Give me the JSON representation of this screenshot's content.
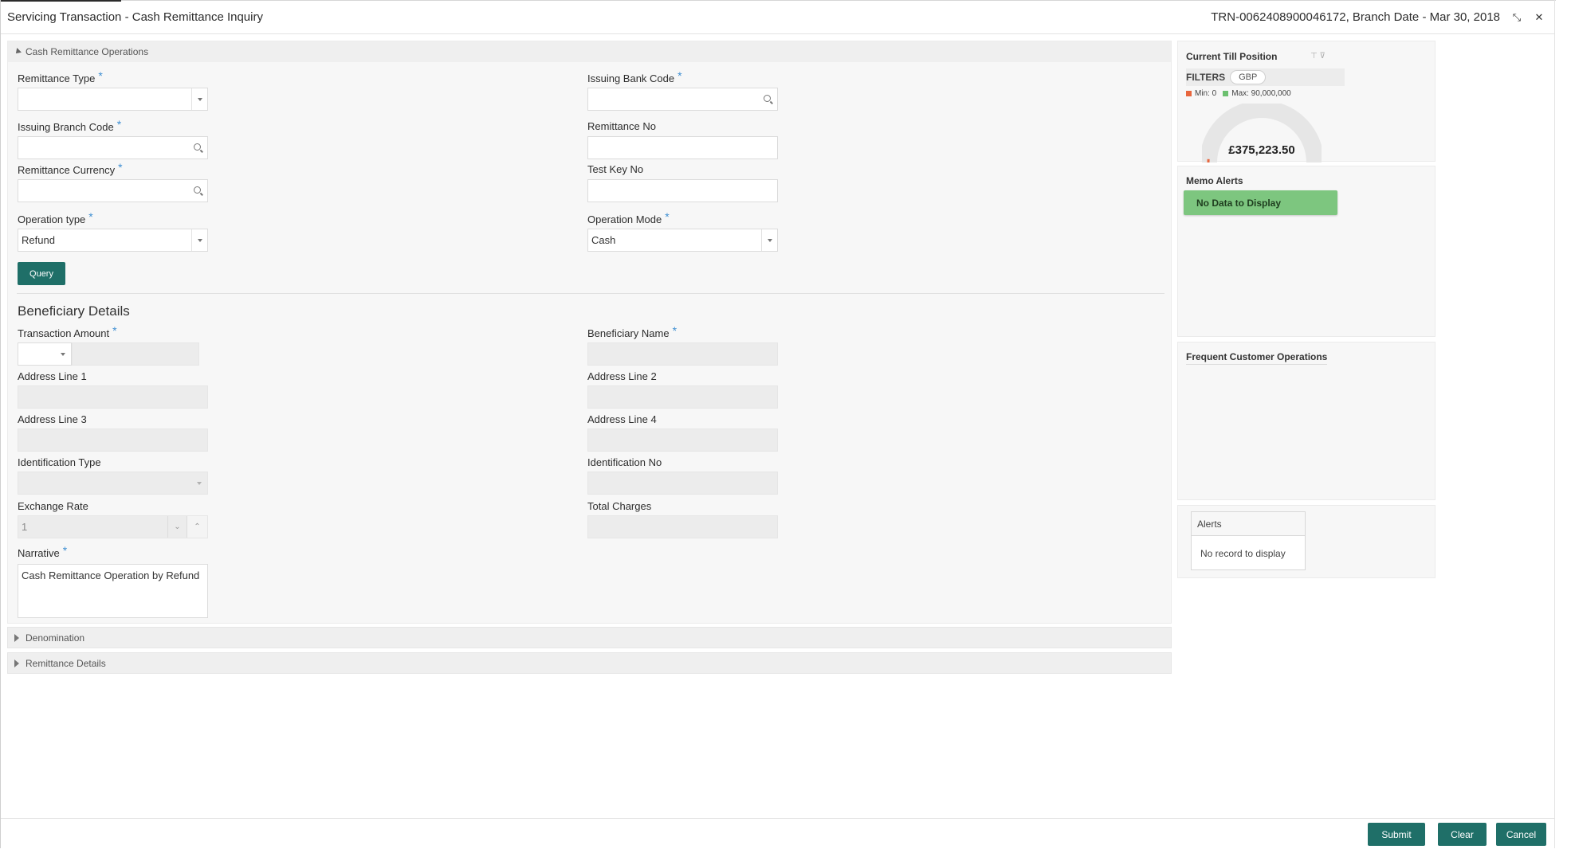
{
  "header": {
    "title": "Servicing Transaction - Cash Remittance Inquiry",
    "transaction_info": "TRN-0062408900046172, Branch Date - Mar 30, 2018"
  },
  "operations": {
    "section_label": "Cash Remittance Operations",
    "remittance_type": {
      "label": "Remittance Type",
      "value": ""
    },
    "issuing_bank_code": {
      "label": "Issuing Bank Code",
      "value": ""
    },
    "issuing_branch_code": {
      "label": "Issuing Branch Code",
      "value": ""
    },
    "remittance_no": {
      "label": "Remittance No",
      "value": ""
    },
    "remittance_currency": {
      "label": "Remittance Currency",
      "value": ""
    },
    "test_key_no": {
      "label": "Test Key No",
      "value": ""
    },
    "operation_type": {
      "label": "Operation type",
      "value": "Refund"
    },
    "operation_mode": {
      "label": "Operation Mode",
      "value": "Cash"
    },
    "query_label": "Query"
  },
  "beneficiary": {
    "section_title": "Beneficiary Details",
    "transaction_amount": {
      "label": "Transaction Amount",
      "currency": "",
      "value": ""
    },
    "beneficiary_name": {
      "label": "Beneficiary Name",
      "value": ""
    },
    "address_line_1": {
      "label": "Address Line 1",
      "value": ""
    },
    "address_line_2": {
      "label": "Address Line 2",
      "value": ""
    },
    "address_line_3": {
      "label": "Address Line 3",
      "value": ""
    },
    "address_line_4": {
      "label": "Address Line 4",
      "value": ""
    },
    "identification_type": {
      "label": "Identification Type",
      "value": ""
    },
    "identification_no": {
      "label": "Identification No",
      "value": ""
    },
    "exchange_rate": {
      "label": "Exchange Rate",
      "value": "1"
    },
    "total_charges": {
      "label": "Total Charges",
      "value": ""
    },
    "narrative": {
      "label": "Narrative",
      "value": "Cash Remittance Operation by Refund"
    }
  },
  "collapsed_sections": {
    "denomination": "Denomination",
    "remittance_details": "Remittance Details"
  },
  "till_position": {
    "title": "Current Till Position",
    "filters_label": "FILTERS",
    "currency_filter": "GBP",
    "min_label": "Min: 0",
    "max_label": "Max: 90,000,000",
    "amount": "£375,223.50",
    "fill_fraction": 0.004,
    "colors": {
      "min": "#e8663d",
      "max": "#6cc070",
      "gauge_track": "#e6e6e6"
    }
  },
  "memo_alerts": {
    "title": "Memo Alerts",
    "no_data_label": "No Data to Display"
  },
  "frequent_ops": {
    "title": "Frequent Customer Operations"
  },
  "alerts": {
    "title": "Alerts",
    "empty_text": "No record to display"
  },
  "footer": {
    "submit_label": "Submit",
    "clear_label": "Clear",
    "cancel_label": "Cancel"
  },
  "theme": {
    "accent": "#1f6f68",
    "required_marker": "#3f8fd2",
    "success": "#7dc67f"
  }
}
